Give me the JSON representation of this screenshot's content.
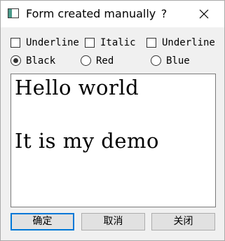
{
  "window": {
    "title": "Form created manually",
    "help_label": "?"
  },
  "checkboxes": [
    {
      "label": "Underline",
      "checked": false
    },
    {
      "label": "Italic",
      "checked": false
    },
    {
      "label": "Underline",
      "checked": false
    }
  ],
  "radios": [
    {
      "label": "Black",
      "selected": true
    },
    {
      "label": "Red",
      "selected": false
    },
    {
      "label": "Blue",
      "selected": false
    }
  ],
  "editor": {
    "lines": [
      "Hello world",
      "It is my demo"
    ]
  },
  "buttons": {
    "ok": "确定",
    "cancel": "取消",
    "close": "关闭"
  },
  "icons": {
    "app": "window-app-icon",
    "close": "close-icon"
  },
  "colors": {
    "accent": "#0078d7",
    "window_bg": "#f0f0f0",
    "titlebar_bg": "#ffffff"
  }
}
